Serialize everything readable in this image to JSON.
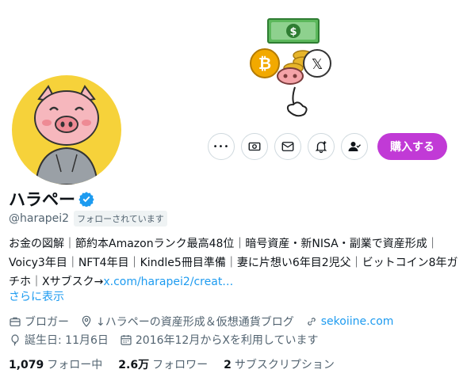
{
  "profile": {
    "name": "ハラペー",
    "handle": "@harapei2",
    "follows_you": "フォローされています",
    "bio_text": "お金の図解｜節約本Amazonランク最高48位｜暗号資産・新NISA・副業で資産形成｜Voicy3年目｜NFT4年目｜Kindle5冊目準備｜妻に片想い6年目2児父｜ビットコイン8年ガチホ｜Xサブスク→",
    "bio_link": "x.com/harapei2/creat…",
    "show_more": "さらに表示"
  },
  "actions": {
    "more_glyph": "•••",
    "buy_label": "購入する"
  },
  "meta": {
    "job": "ブロガー",
    "location": "↓ハラペーの資産形成＆仮想通貨ブログ",
    "website": "sekoiine.com",
    "birthday": "誕生日: 11月6日",
    "joined": "2016年12月からXを利用しています"
  },
  "stats": {
    "following_count": "1,079",
    "following_label": "フォロー中",
    "followers_count": "2.6万",
    "followers_label": "フォロワー",
    "subs_count": "2",
    "subs_label": "サブスクリプション"
  },
  "banner": {
    "dollar_sign": "$",
    "btc_glyph": "₿",
    "x_glyph": "𝕏"
  },
  "colors": {
    "accent": "#1d9bf0",
    "buy_button": "#c13ad6",
    "avatar_bg": "#f6d23a"
  }
}
